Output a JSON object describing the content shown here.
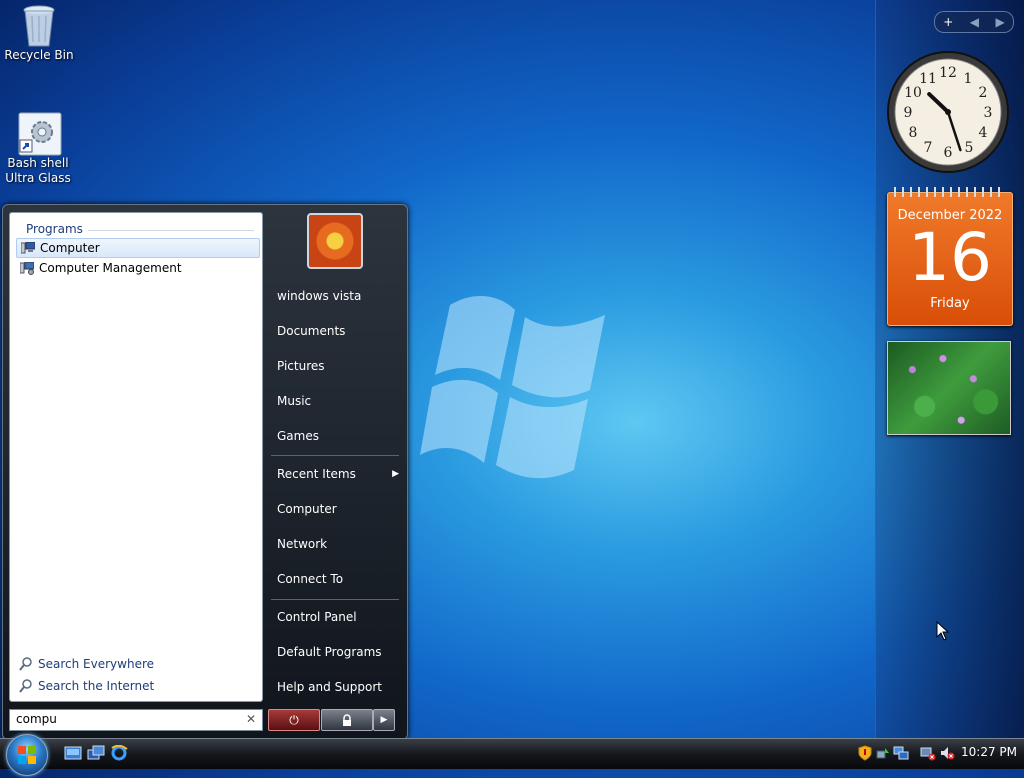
{
  "desktop": {
    "icons": [
      {
        "label": "Recycle Bin",
        "icon": "recycle-bin-icon"
      },
      {
        "label_line1": "Bash shell",
        "label_line2": "Ultra Glass",
        "icon": "shortcut-gear-icon"
      }
    ]
  },
  "sidebar": {
    "controls": {
      "add": "+",
      "prev": "◀",
      "next": "▶"
    },
    "clock": {
      "hour": 10,
      "minute": 27
    },
    "calendar": {
      "month_year": "December 2022",
      "day": "16",
      "weekday": "Friday"
    }
  },
  "start_menu": {
    "programs_header": "Programs",
    "programs": [
      {
        "label": "Computer",
        "selected": true,
        "icon": "computer-icon"
      },
      {
        "label": "Computer Management",
        "selected": false,
        "icon": "computer-management-icon"
      }
    ],
    "search_everywhere": "Search Everywhere",
    "search_internet": "Search the Internet",
    "search_value": "compu",
    "clear_label": "✕",
    "right_items": [
      {
        "label": "windows vista"
      },
      {
        "label": "Documents"
      },
      {
        "label": "Pictures"
      },
      {
        "label": "Music"
      },
      {
        "label": "Games"
      },
      {
        "label": "Recent Items",
        "has_submenu": true
      },
      {
        "label": "Computer"
      },
      {
        "label": "Network"
      },
      {
        "label": "Connect To"
      },
      {
        "label": "Control Panel"
      },
      {
        "label": "Default Programs"
      },
      {
        "label": "Help and Support"
      }
    ],
    "submenu_arrow": "▶",
    "power_glyph": "⏻",
    "arrow_glyph": "▶"
  },
  "taskbar": {
    "time": "10:27 PM"
  },
  "colors": {
    "accent": "#1e3e7a",
    "calendar": "#e0560e",
    "selection": "#d8e8fa"
  }
}
